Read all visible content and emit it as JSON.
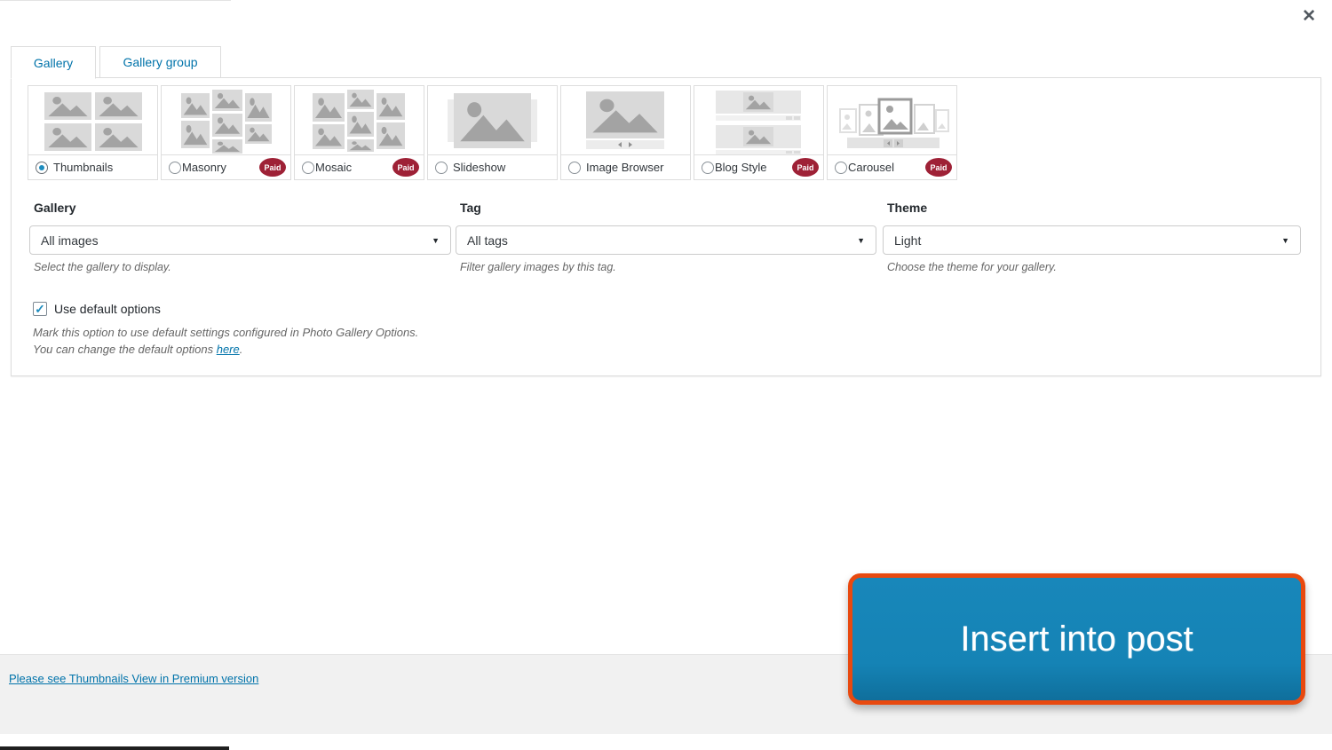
{
  "modal": {
    "close_icon": "✕"
  },
  "labels": {
    "paid": "Paid"
  },
  "tabs": [
    {
      "label": "Gallery",
      "active": true
    },
    {
      "label": "Gallery group",
      "active": false
    }
  ],
  "gallery_types": [
    {
      "label": "Thumbnails",
      "selected": true,
      "paid": false
    },
    {
      "label": "Masonry",
      "selected": false,
      "paid": true
    },
    {
      "label": "Mosaic",
      "selected": false,
      "paid": true
    },
    {
      "label": "Slideshow",
      "selected": false,
      "paid": false
    },
    {
      "label": "Image Browser",
      "selected": false,
      "paid": false
    },
    {
      "label": "Blog Style",
      "selected": false,
      "paid": true
    },
    {
      "label": "Carousel",
      "selected": false,
      "paid": true
    }
  ],
  "filters": {
    "gallery": {
      "label": "Gallery",
      "value": "All images",
      "help": "Select the gallery to display."
    },
    "tag": {
      "label": "Tag",
      "value": "All tags",
      "help": "Filter gallery images by this tag."
    },
    "theme": {
      "label": "Theme",
      "value": "Light",
      "help": "Choose the theme for your gallery."
    }
  },
  "default_options": {
    "label": "Use default options",
    "checked": true,
    "checkmark": "✓",
    "help_line1": "Mark this option to use default settings configured in Photo Gallery Options.",
    "help_line2_prefix": "You can change the default options ",
    "help_link_text": "here",
    "help_line2_suffix": "."
  },
  "footer": {
    "premium_link": "Please see Thumbnails View in Premium version",
    "insert_button_label": "Insert into post"
  },
  "colors": {
    "accent_blue": "#0073aa",
    "button_blue": "#1583b5",
    "button_border_orange": "#e8490f",
    "paid_badge_red": "#9e2136",
    "radio_selected_blue": "#1e8cbe"
  }
}
